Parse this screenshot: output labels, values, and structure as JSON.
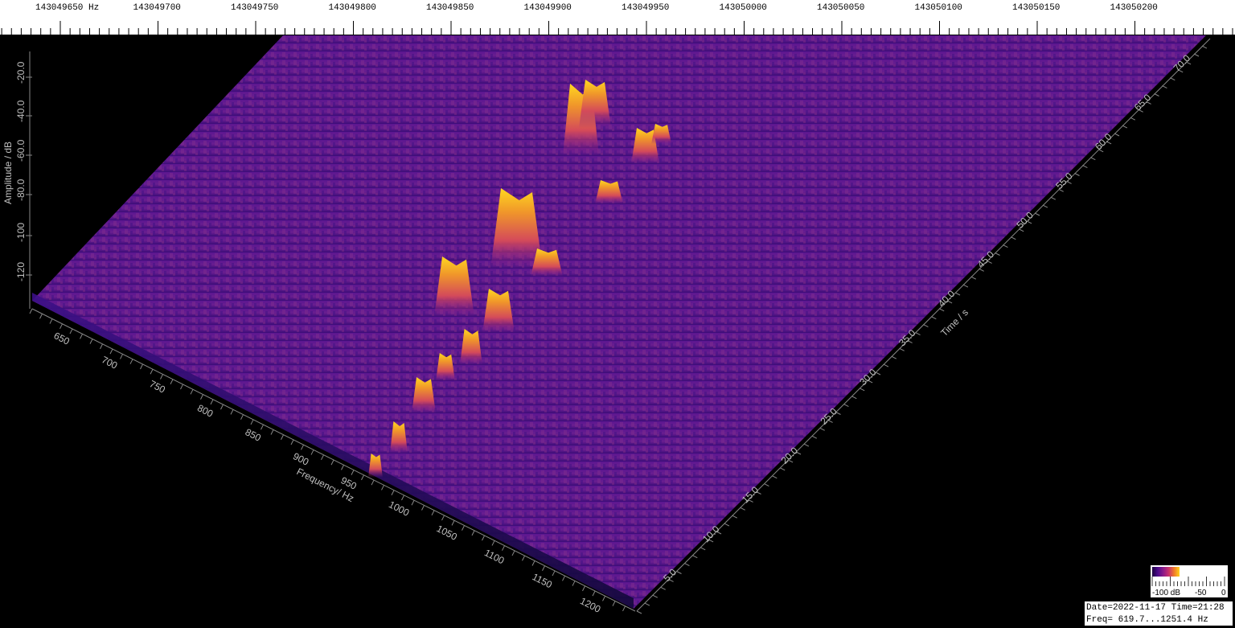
{
  "top_ruler": {
    "unit": "Hz",
    "labels": [
      "143049650",
      "143049700",
      "143049750",
      "143049800",
      "143049850",
      "143049900",
      "143049950",
      "143050000",
      "143050050",
      "143050100",
      "143050150",
      "143050200"
    ]
  },
  "amplitude_axis": {
    "title": "Amplitude / dB",
    "ticks": [
      "-20.0",
      "-40.0",
      "-60.0",
      "-80.0",
      "-100",
      "-120"
    ]
  },
  "frequency_axis": {
    "title": "Frequency/ Hz",
    "ticks": [
      "650",
      "700",
      "750",
      "800",
      "850",
      "900",
      "950",
      "1000",
      "1050",
      "1100",
      "1150",
      "1200"
    ]
  },
  "time_axis": {
    "title": "Time / s",
    "ticks": [
      "5.0",
      "10.0",
      "15.0",
      "20.0",
      "25.0",
      "30.0",
      "35.0",
      "40.0",
      "45.0",
      "50.0",
      "55.0",
      "60.0",
      "65.0",
      "70.0"
    ]
  },
  "color_legend": {
    "label_min": "-100 dB",
    "label_mid": "-50",
    "label_max": "0",
    "colors": [
      "#1a0040",
      "#4b0a8a",
      "#8a1a8a",
      "#c8306e",
      "#f07a2a",
      "#ffd21a"
    ]
  },
  "info": {
    "date_line": "Date=2022-11-17 Time=21:28",
    "freq_line": "Freq= 619.7...1251.4 Hz"
  }
}
